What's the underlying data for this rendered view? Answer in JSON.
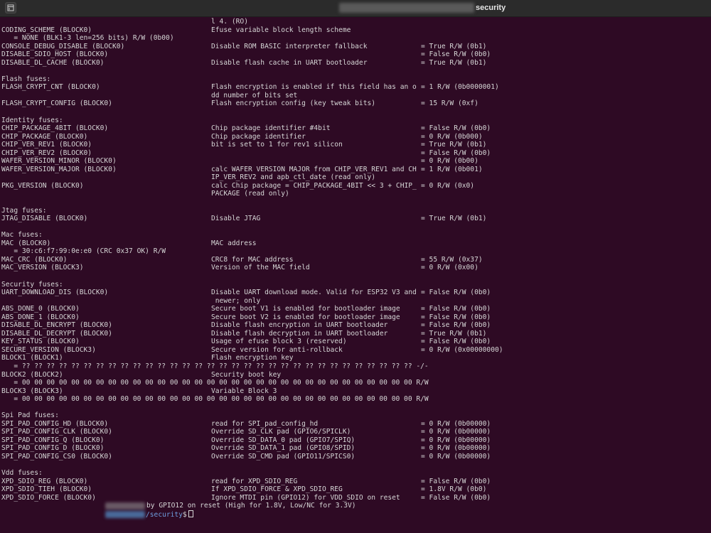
{
  "titlebar": {
    "title_suffix": "security"
  },
  "terminal": {
    "lines": [
      {
        "c1": "",
        "c2": "l 4. (RO)",
        "c3": ""
      },
      {
        "c1": "CODING_SCHEME (BLOCK0)",
        "c2": "Efuse variable block length scheme",
        "c3": ""
      },
      {
        "c1": "   = NONE (BLK1-3 len=256 bits) R/W (0b00)",
        "c2": "",
        "c3": ""
      },
      {
        "c1": "CONSOLE_DEBUG_DISABLE (BLOCK0)",
        "c2": "Disable ROM BASIC interpreter fallback",
        "c3": "= True R/W (0b1)"
      },
      {
        "c1": "DISABLE_SDIO_HOST (BLOCK0)",
        "c2": "",
        "c3": "= False R/W (0b0)"
      },
      {
        "c1": "DISABLE_DL_CACHE (BLOCK0)",
        "c2": "Disable flash cache in UART bootloader",
        "c3": "= True R/W (0b1)"
      },
      {
        "c1": "",
        "c2": "",
        "c3": ""
      },
      {
        "c1": "Flash fuses:",
        "c2": "",
        "c3": ""
      },
      {
        "c1": "FLASH_CRYPT_CNT (BLOCK0)",
        "c2": "Flash encryption is enabled if this field has an o",
        "c3": "= 1 R/W (0b0000001)"
      },
      {
        "c1": "",
        "c2": "dd number of bits set",
        "c3": ""
      },
      {
        "c1": "FLASH_CRYPT_CONFIG (BLOCK0)",
        "c2": "Flash encryption config (key tweak bits)",
        "c3": "= 15 R/W (0xf)"
      },
      {
        "c1": "",
        "c2": "",
        "c3": ""
      },
      {
        "c1": "Identity fuses:",
        "c2": "",
        "c3": ""
      },
      {
        "c1": "CHIP_PACKAGE_4BIT (BLOCK0)",
        "c2": "Chip package identifier #4bit",
        "c3": "= False R/W (0b0)"
      },
      {
        "c1": "CHIP_PACKAGE (BLOCK0)",
        "c2": "Chip package identifier",
        "c3": "= 0 R/W (0b000)"
      },
      {
        "c1": "CHIP_VER_REV1 (BLOCK0)",
        "c2": "bit is set to 1 for rev1 silicon",
        "c3": "= True R/W (0b1)"
      },
      {
        "c1": "CHIP_VER_REV2 (BLOCK0)",
        "c2": "",
        "c3": "= False R/W (0b0)"
      },
      {
        "c1": "WAFER_VERSION_MINOR (BLOCK0)",
        "c2": "",
        "c3": "= 0 R/W (0b00)"
      },
      {
        "c1": "WAFER_VERSION_MAJOR (BLOCK0)",
        "c2": "calc WAFER VERSION MAJOR from CHIP_VER_REV1 and CH",
        "c3": "= 1 R/W (0b001)"
      },
      {
        "c1": "",
        "c2": "IP_VER_REV2 and apb_ctl_date (read only)",
        "c3": ""
      },
      {
        "c1": "PKG_VERSION (BLOCK0)",
        "c2": "calc Chip package = CHIP_PACKAGE_4BIT << 3 + CHIP_",
        "c3": "= 0 R/W (0x0)"
      },
      {
        "c1": "",
        "c2": "PACKAGE (read only)",
        "c3": ""
      },
      {
        "c1": "",
        "c2": "",
        "c3": ""
      },
      {
        "c1": "Jtag fuses:",
        "c2": "",
        "c3": ""
      },
      {
        "c1": "JTAG_DISABLE (BLOCK0)",
        "c2": "Disable JTAG",
        "c3": "= True R/W (0b1)"
      },
      {
        "c1": "",
        "c2": "",
        "c3": ""
      },
      {
        "c1": "Mac fuses:",
        "c2": "",
        "c3": ""
      },
      {
        "c1": "MAC (BLOCK0)",
        "c2": "MAC address",
        "c3": ""
      },
      {
        "c1": "   = 30:c6:f7:99:0e:e0 (CRC 0x37 OK) R/W",
        "c2": "",
        "c3": ""
      },
      {
        "c1": "MAC_CRC (BLOCK0)",
        "c2": "CRC8 for MAC address",
        "c3": "= 55 R/W (0x37)"
      },
      {
        "c1": "MAC_VERSION (BLOCK3)",
        "c2": "Version of the MAC field",
        "c3": "= 0 R/W (0x00)"
      },
      {
        "c1": "",
        "c2": "",
        "c3": ""
      },
      {
        "c1": "Security fuses:",
        "c2": "",
        "c3": ""
      },
      {
        "c1": "UART_DOWNLOAD_DIS (BLOCK0)",
        "c2": "Disable UART download mode. Valid for ESP32 V3 and",
        "c3": "= False R/W (0b0)"
      },
      {
        "c1": "",
        "c2": " newer; only",
        "c3": ""
      },
      {
        "c1": "ABS_DONE_0 (BLOCK0)",
        "c2": "Secure boot V1 is enabled for bootloader image",
        "c3": "= False R/W (0b0)"
      },
      {
        "c1": "ABS_DONE_1 (BLOCK0)",
        "c2": "Secure boot V2 is enabled for bootloader image",
        "c3": "= False R/W (0b0)"
      },
      {
        "c1": "DISABLE_DL_ENCRYPT (BLOCK0)",
        "c2": "Disable flash encryption in UART bootloader",
        "c3": "= False R/W (0b0)"
      },
      {
        "c1": "DISABLE_DL_DECRYPT (BLOCK0)",
        "c2": "Disable flash decryption in UART bootloader",
        "c3": "= True R/W (0b1)"
      },
      {
        "c1": "KEY_STATUS (BLOCK0)",
        "c2": "Usage of efuse block 3 (reserved)",
        "c3": "= False R/W (0b0)"
      },
      {
        "c1": "SECURE_VERSION (BLOCK3)",
        "c2": "Secure version for anti-rollback",
        "c3": "= 0 R/W (0x00000000)"
      },
      {
        "c1": "BLOCK1 (BLOCK1)",
        "c2": "Flash encryption key",
        "c3": ""
      },
      {
        "c1": "   = ?? ?? ?? ?? ?? ?? ?? ?? ?? ?? ?? ?? ?? ?? ?? ?? ?? ?? ?? ?? ?? ?? ?? ?? ?? ?? ?? ?? ?? ?? ?? ?? -/-",
        "c2": "",
        "c3": ""
      },
      {
        "c1": "BLOCK2 (BLOCK2)",
        "c2": "Security boot key",
        "c3": ""
      },
      {
        "c1": "   = 00 00 00 00 00 00 00 00 00 00 00 00 00 00 00 00 00 00 00 00 00 00 00 00 00 00 00 00 00 00 00 00 R/W",
        "c2": "",
        "c3": ""
      },
      {
        "c1": "BLOCK3 (BLOCK3)",
        "c2": "Variable Block 3",
        "c3": ""
      },
      {
        "c1": "   = 00 00 00 00 00 00 00 00 00 00 00 00 00 00 00 00 00 00 00 00 00 00 00 00 00 00 00 00 00 00 00 00 R/W",
        "c2": "",
        "c3": ""
      },
      {
        "c1": "",
        "c2": "",
        "c3": ""
      },
      {
        "c1": "Spi Pad fuses:",
        "c2": "",
        "c3": ""
      },
      {
        "c1": "SPI_PAD_CONFIG_HD (BLOCK0)",
        "c2": "read for SPI_pad_config_hd",
        "c3": "= 0 R/W (0b00000)"
      },
      {
        "c1": "SPI_PAD_CONFIG_CLK (BLOCK0)",
        "c2": "Override SD_CLK pad (GPIO6/SPICLK)",
        "c3": "= 0 R/W (0b00000)"
      },
      {
        "c1": "SPI_PAD_CONFIG_Q (BLOCK0)",
        "c2": "Override SD_DATA_0 pad (GPIO7/SPIQ)",
        "c3": "= 0 R/W (0b00000)"
      },
      {
        "c1": "SPI_PAD_CONFIG_D (BLOCK0)",
        "c2": "Override SD_DATA_1 pad (GPIO8/SPID)",
        "c3": "= 0 R/W (0b00000)"
      },
      {
        "c1": "SPI_PAD_CONFIG_CS0 (BLOCK0)",
        "c2": "Override SD_CMD pad (GPIO11/SPICS0)",
        "c3": "= 0 R/W (0b00000)"
      },
      {
        "c1": "",
        "c2": "",
        "c3": ""
      },
      {
        "c1": "Vdd fuses:",
        "c2": "",
        "c3": ""
      },
      {
        "c1": "XPD_SDIO_REG (BLOCK0)",
        "c2": "read for XPD_SDIO_REG",
        "c3": "= False R/W (0b0)"
      },
      {
        "c1": "XPD_SDIO_TIEH (BLOCK0)",
        "c2": "If XPD_SDIO_FORCE & XPD_SDIO_REG",
        "c3": "= 1.8V R/W (0b0)"
      },
      {
        "c1": "XPD_SDIO_FORCE (BLOCK0)",
        "c2": "Ignore MTDI pin (GPIO12) for VDD_SDIO on reset",
        "c3": "= False R/W (0b0)"
      }
    ],
    "last_line": "by GPIO12 on reset (High for 1.8V, Low/NC for 3.3V)",
    "prompt_path": "/security",
    "prompt_symbol": "$"
  }
}
